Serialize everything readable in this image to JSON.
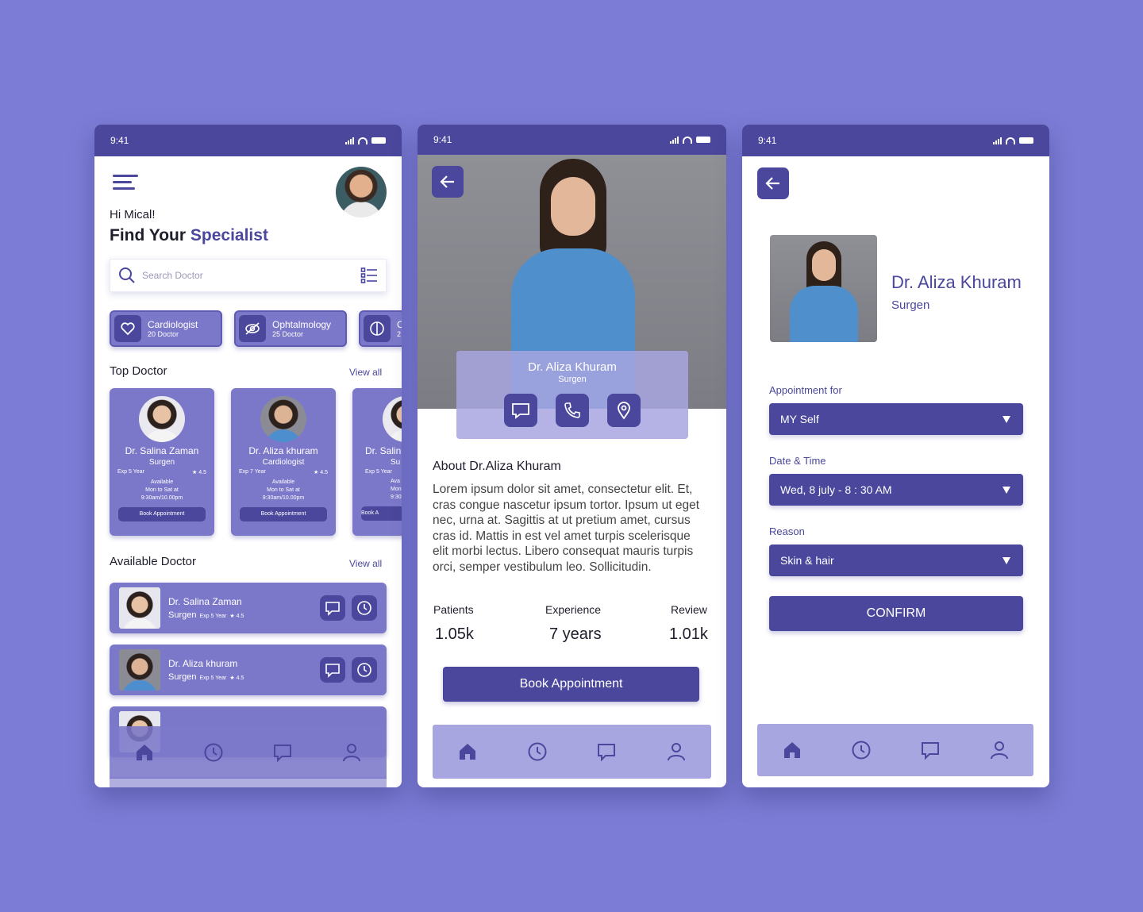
{
  "status": {
    "time": "9:41"
  },
  "home": {
    "greeting": "Hi Mical!",
    "headline_prefix": "Find Your ",
    "headline_accent": "Specialist",
    "search_placeholder": "Search Doctor",
    "categories": [
      {
        "name": "Cardiologist",
        "count": "20 Doctor",
        "icon": "heart-icon"
      },
      {
        "name": "Ophtalmology",
        "count": "25 Doctor",
        "icon": "eye-off-icon"
      },
      {
        "name": "C",
        "count": "2",
        "icon": "brain-icon"
      }
    ],
    "top_doctor_title": "Top Doctor",
    "available_doctor_title": "Available Doctor",
    "view_all": "View all",
    "top_doctors": [
      {
        "name": "Dr. Salina Zaman",
        "specialty": "Surgen",
        "exp": "Exp 5 Year",
        "rating": "★ 4.5",
        "available": "Available",
        "days": "Mon to Sat at",
        "hours": "9:30am/10.00pm",
        "book": "Book Appointment"
      },
      {
        "name": "Dr. Aliza khuram",
        "specialty": "Cardiologist",
        "exp": "Exp 7 Year",
        "rating": "★ 4.5",
        "available": "Available",
        "days": "Mon to Sat at",
        "hours": "9:30am/10.00pm",
        "book": "Book Appointment"
      },
      {
        "name": "Dr. Salin",
        "specialty": "Su",
        "exp": "Exp 5 Year",
        "rating": "",
        "available": "Ava",
        "days": "Mon t",
        "hours": "9:30am",
        "book": "Book A"
      }
    ],
    "available_doctors": [
      {
        "name": "Dr. Salina Zaman",
        "specialty": "Surgen",
        "exp": "Exp 5 Year",
        "rating": "★ 4.5"
      },
      {
        "name": "Dr. Aliza khuram",
        "specialty": "Surgen",
        "exp": "Exp 5 Year",
        "rating": "★ 4.5"
      }
    ]
  },
  "profile": {
    "name": "Dr. Aliza Khuram",
    "specialty": "Surgen",
    "about_title": "About Dr.Aliza Khuram",
    "about_text": "Lorem ipsum dolor sit amet, consectetur elit. Et, cras congue nascetur ipsum tortor. Ipsum ut eget nec, urna at. Sagittis at ut pretium amet, cursus cras id. Mattis in est vel amet turpis scelerisque elit morbi lectus. Libero consequat mauris turpis orci, semper vestibulum leo. Sollicitudin.",
    "stats": [
      {
        "label": "Patients",
        "value": "1.05k"
      },
      {
        "label": "Experience",
        "value": "7 years"
      },
      {
        "label": "Review",
        "value": "1.01k"
      }
    ],
    "book_label": "Book Appointment"
  },
  "booking": {
    "name": "Dr. Aliza Khuram",
    "specialty": "Surgen",
    "fields": [
      {
        "label": "Appointment for",
        "value": "MY Self"
      },
      {
        "label": "Date & Time",
        "value": "Wed, 8 july - 8 : 30 AM"
      },
      {
        "label": "Reason",
        "value": "Skin & hair"
      }
    ],
    "confirm_label": "CONFIRM"
  },
  "nav_icons": [
    "home-icon",
    "clock-icon",
    "chat-icon",
    "user-icon"
  ],
  "colors": {
    "background": "#7c7cd6",
    "primary": "#4a479c",
    "card": "#7c78c9",
    "light": "#a8a6e0"
  }
}
